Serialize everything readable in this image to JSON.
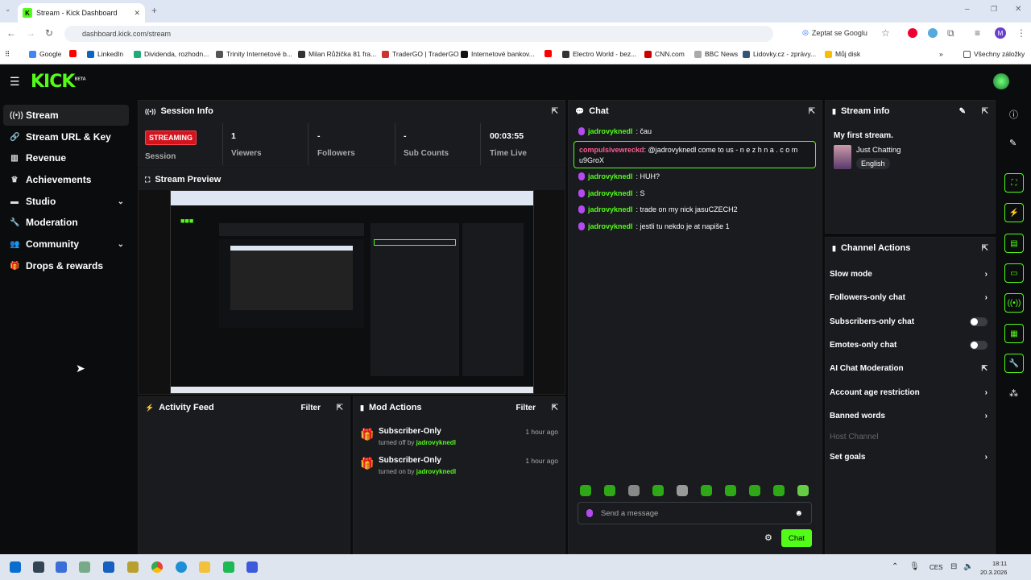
{
  "browser": {
    "tab_title": "Stream - Kick Dashboard",
    "url": "dashboard.kick.com/stream",
    "ask_google": "Zeptat se Googlu",
    "profile_initial": "M",
    "bookmarks": [
      "Google",
      "LinkedIn",
      "Dividenda, rozhodn...",
      "Trinity Internetové b...",
      "Milan Růžička 81 fra...",
      "TraderGO | TraderGO",
      "Internetové bankov...",
      "Electro World - bez...",
      "CNN.com",
      "BBC News",
      "Lidovky.cz - zprávy...",
      "Můj disk"
    ],
    "all_bookmarks": "Všechny záložky"
  },
  "app": {
    "logo": "KICK",
    "logo_beta": "BETA",
    "accent": "#53fc18",
    "nav": [
      {
        "label": "Stream"
      },
      {
        "label": "Stream URL & Key"
      },
      {
        "label": "Revenue"
      },
      {
        "label": "Achievements"
      },
      {
        "label": "Studio"
      },
      {
        "label": "Moderation"
      },
      {
        "label": "Community"
      },
      {
        "label": "Drops & rewards"
      }
    ]
  },
  "session": {
    "title": "Session Info",
    "status": "STREAMING",
    "session_label": "Session",
    "viewers": "1",
    "viewers_label": "Viewers",
    "followers": "-",
    "followers_label": "Followers",
    "subs": "-",
    "subs_label": "Sub Counts",
    "time": "00:03:55",
    "time_label": "Time Live"
  },
  "preview": {
    "title": "Stream Preview"
  },
  "activity": {
    "title": "Activity Feed",
    "filter": "Filter"
  },
  "mod": {
    "title": "Mod Actions",
    "filter": "Filter",
    "items": [
      {
        "title": "Subscriber-Only",
        "action": "turned off by",
        "user": "jadrovyknedl",
        "time": "1 hour ago"
      },
      {
        "title": "Subscriber-Only",
        "action": "turned on by",
        "user": "jadrovyknedl",
        "time": "1 hour ago"
      }
    ]
  },
  "chat": {
    "title": "Chat",
    "messages": [
      {
        "user": "jadrovyknedl",
        "text": ": čau"
      },
      {
        "user": "compulsivewreckd",
        "text": ": @jadrovyknedl come to us - n e z h n a . c o m u9GroX"
      },
      {
        "user": "jadrovyknedl",
        "text": ": HUH?"
      },
      {
        "user": "jadrovyknedl",
        "text": ": S"
      },
      {
        "user": "jadrovyknedl",
        "text": ": trade on my nick jasuCZECH2"
      },
      {
        "user": "jadrovyknedl",
        "text": ": jestli tu nekdo je at napiše 1"
      }
    ],
    "placeholder": "Send a message",
    "send": "Chat"
  },
  "stream_info": {
    "title": "Stream info",
    "stream_title": "My first stream.",
    "category": "Just Chatting",
    "language": "English"
  },
  "channel_actions": {
    "title": "Channel Actions",
    "items": [
      "Slow mode",
      "Followers-only chat",
      "Subscribers-only chat",
      "Emotes-only chat",
      "AI Chat Moderation",
      "Account age restriction",
      "Banned words",
      "Host Channel",
      "Set goals"
    ]
  },
  "taskbar": {
    "lang": "CES",
    "time": "18:11",
    "date": "20.3.2026"
  }
}
